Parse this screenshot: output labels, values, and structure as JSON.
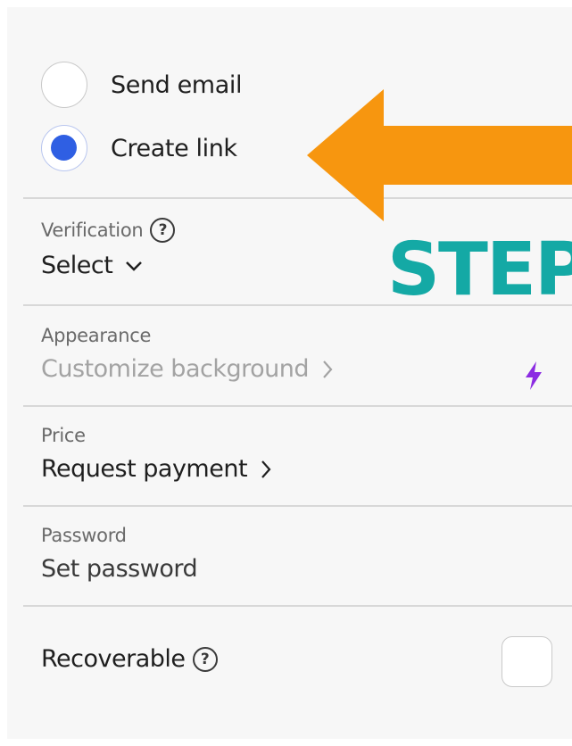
{
  "delivery_options": [
    {
      "label": "Send email",
      "checked": false
    },
    {
      "label": "Create link",
      "checked": true
    }
  ],
  "verification": {
    "label": "Verification",
    "value": "Select"
  },
  "appearance": {
    "label": "Appearance",
    "value": "Customize background"
  },
  "price": {
    "label": "Price",
    "value": "Request payment"
  },
  "password": {
    "label": "Password",
    "value": "Set password"
  },
  "recoverable": {
    "label": "Recoverable",
    "checked": false
  },
  "annotation": {
    "text": "STEP",
    "arrow_color": "#f7960f",
    "text_color": "#14a9a5"
  },
  "colors": {
    "accent": "#2f5fe3",
    "premium_bolt": "#8b2be2"
  }
}
